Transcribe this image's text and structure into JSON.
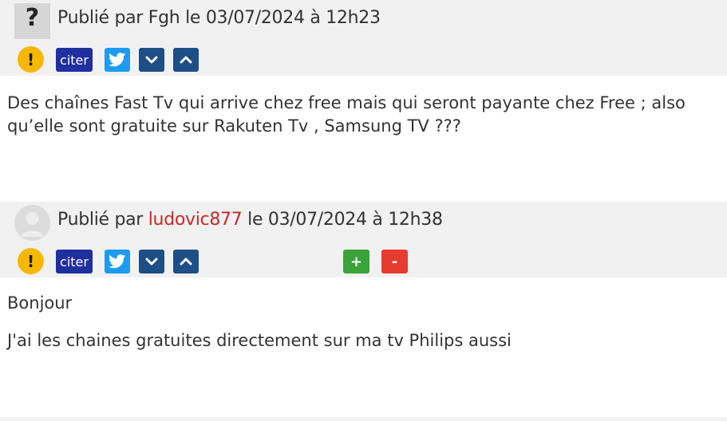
{
  "posts": [
    {
      "byline_prefix": "Publié par ",
      "author": "Fgh",
      "byline_suffix": " le 03/07/2024 à 12h23",
      "avatar_glyph": "?",
      "actions": {
        "warn": "!",
        "citer": "citer",
        "twitter_icon": "twitter-icon",
        "down_icon": "chevron-down-icon",
        "up_icon": "chevron-up-icon"
      },
      "body": [
        "Des chaînes Fast Tv qui arrive chez free mais qui seront payante chez Free ; also qu’elle sont gratuite sur Rakuten Tv , Samsung TV ???"
      ]
    },
    {
      "byline_prefix": "Publié par ",
      "author": "ludovic877",
      "byline_suffix": " le 03/07/2024 à 12h38",
      "actions": {
        "warn": "!",
        "citer": "citer",
        "plus": "+",
        "minus": "-"
      },
      "body": [
        "Bonjour",
        "J'ai les chaines gratuites directement sur ma tv Philips aussi"
      ]
    }
  ],
  "colors": {
    "header_bg": "#f1f1f1",
    "author_link": "#c62828",
    "citer_bg": "#1f2f9e",
    "twitter_bg": "#1d9bf0",
    "vote_plus": "#3aa33a",
    "vote_minus": "#e63b2e"
  }
}
